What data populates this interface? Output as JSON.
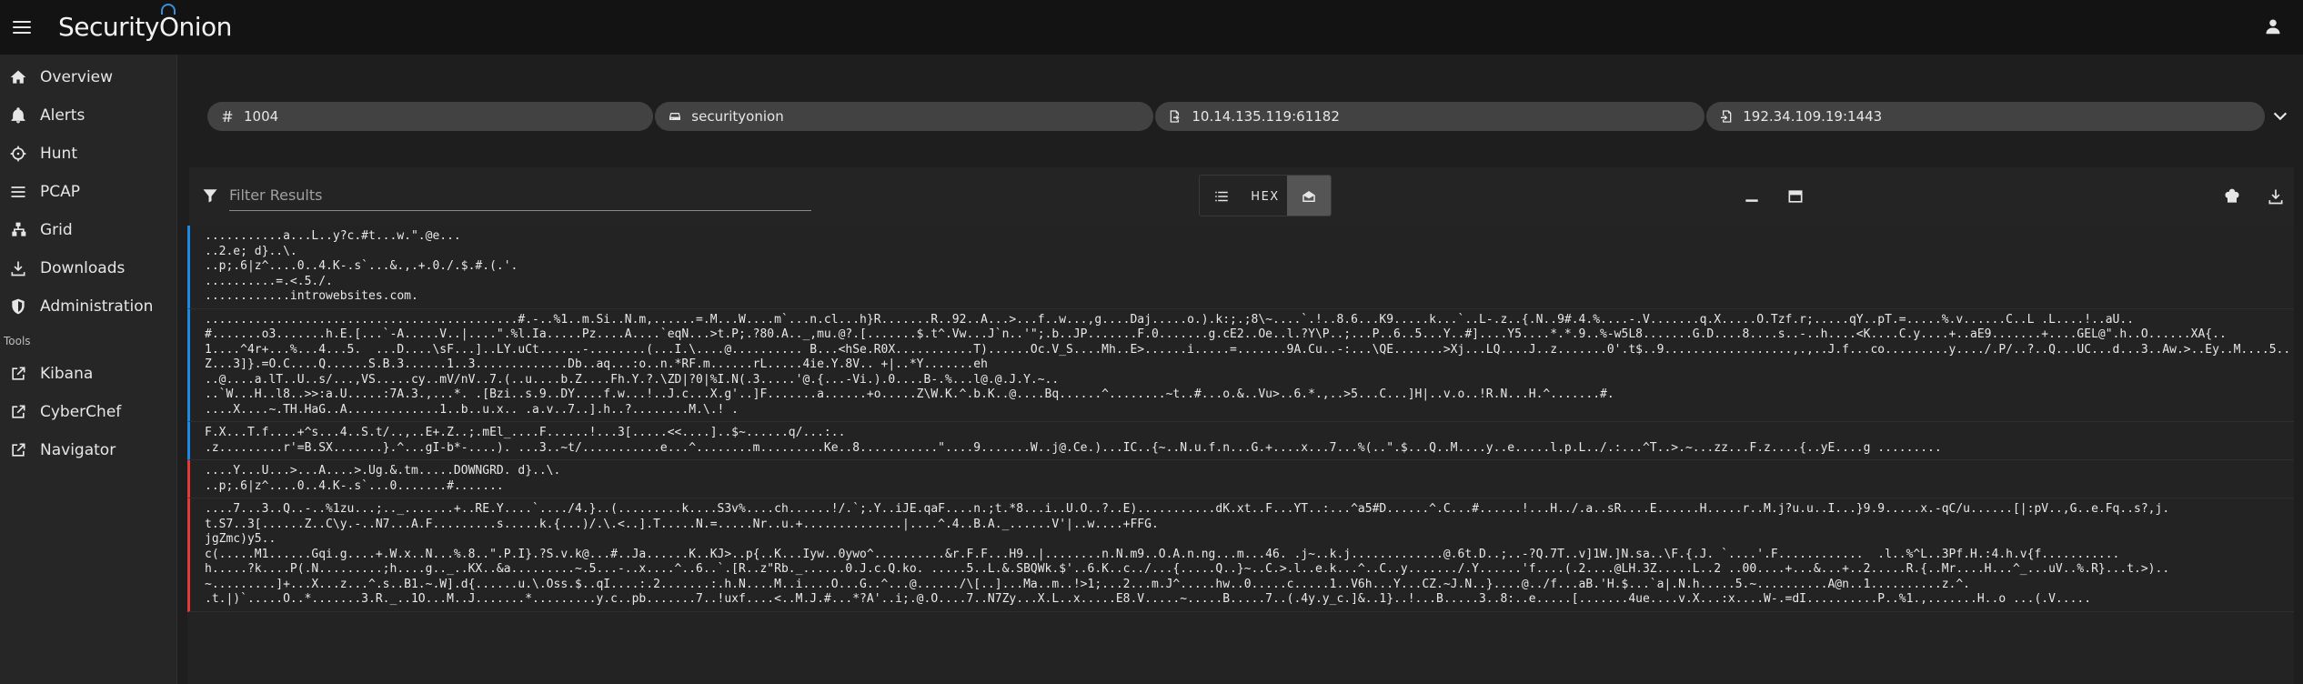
{
  "app": {
    "logo_text_1": "Security",
    "logo_text_2": "Onion"
  },
  "sidebar": {
    "items": [
      {
        "label": "Overview",
        "icon": "home-icon"
      },
      {
        "label": "Alerts",
        "icon": "bell-icon"
      },
      {
        "label": "Hunt",
        "icon": "crosshairs-icon"
      },
      {
        "label": "PCAP",
        "icon": "list-icon"
      },
      {
        "label": "Grid",
        "icon": "sitemap-icon"
      },
      {
        "label": "Downloads",
        "icon": "download-icon"
      },
      {
        "label": "Administration",
        "icon": "shield-icon"
      }
    ],
    "tools_label": "Tools",
    "tools": [
      {
        "label": "Kibana",
        "icon": "external-link-icon"
      },
      {
        "label": "CyberChef",
        "icon": "external-link-icon"
      },
      {
        "label": "Navigator",
        "icon": "external-link-icon"
      }
    ]
  },
  "chips": {
    "id": "1004",
    "sensor": "securityonion",
    "source": "10.14.135.119:61182",
    "destination": "192.34.109.19:1443"
  },
  "toolbar": {
    "filter_placeholder": "Filter Results",
    "hex_label": "HEX"
  },
  "colors": {
    "source_packet": "#1e88e5",
    "destination_packet": "#e53935",
    "active_button": "#555555"
  },
  "packets": [
    {
      "direction": "src",
      "lines": [
        "...........a...L..y?c.#t...w.\".@e...",
        "..2.e; d}..\\.",
        "..p;.6|z^....0..4.K-.s`...&.,.+.0./.$.#.(.'.",
        "..........=.<.5./.",
        "............introwebsites.com."
      ]
    },
    {
      "direction": "src",
      "lines": [
        "............................................#.-..%1..m.Si..N.m,......=.M...W....m`...n.cl...h}R.......R..92..A...>...f..w...,g....Daj.....o.).k:;.;8\\~....`.!..8.6...K9.....k...`..L-.z..{.N..9#.4.%....-.V.......q.X.....O.Tzf.r;.....qY..pT.=.....%.v......C..L .L....!..aU..",
        "#.......o3.......h.E.[...`-A.....V..|....\".%l.Ia.....Pz....A....`eqN...>t.P;.?80.A.._,mu.@?.[.......$.t^.Vw...J`n..'\";.b..JP.......F.0.......g.cE2..Oe..l.?Y\\P..;...P..6..5...Y..#]....Y5....*.*.9..%-w5L8.......G.D....8....s..-..h....<K....C.y....+..aE9.......+....GEL@\".h..O......XA{..",
        "1....^4r+...%...4...5.  ...D....\\sF...]..LY.uCt......-........(...I.\\....@.......... B...<hSe.R0X...........T)......Oc.V_S....Mh..E>......i.....=.......9A.Cu..-:...\\QE.......>Xj...LQ....J..z.......0'.t$..9..................,.,..J.f...co.........y..../.P/..?..Q...UC...d...3..Aw.>..Ey..M....5..",
        "Z...3]}.=O.C....Q......S.B.3......1..3.............Db..aq...:o..n.*RF.m......rL.....4ie.Y.8V.. +|..*Y.......eh",
        "..@....a.lT..U..s/...,VS.....cy..mV/nV..7.(..u....b.Z....Fh.Y.?.\\ZD|?0|%I.N(.3.....'@.{...-Vi.).0....B-.%...l@.@.J.Y.~..",
        "..`W...H..l8..>>:a.U.....:7A.3.,...*. .[Bzi..s.9..DY....f.w...!..J.c...X.g'..]F.......a......+o.....Z\\W.K.^.b.K..@....Bq......^........~t..#...o.&..Vu>..6.*.,..>5...C...]H|..v.o..!R.N...H.^.......#.",
        "....X....~.TH.HaG..A.............1..b..u.x.. .a.v..7..].h..?........M.\\.! ."
      ]
    },
    {
      "direction": "src",
      "lines": [
        "F.X...T.f....+^s...4..S.t/..,..E+.Z..;.mEl_....F......!...3[.....<<....]..$~......q/...:..",
        ".z.........r'=B.SX.......}.^...gI-b*-....). ...3..~t/...........e...^........m.........Ke..8...........\"....9.......W..j@.Ce.)...IC..{~..N.u.f.n...G.+....x...7...%(..\".$...Q..M....y..e.....l.p.L../.:...^T..>.~...zz...F.z....{..yE....g ........."
      ]
    },
    {
      "direction": "dst",
      "lines": [
        "....Y...U...>...A....>.Ug.&.tm.....DOWNGRD. d}..\\.",
        "..p;.6|z^....0..4.K-.s`...0.......#......."
      ]
    },
    {
      "direction": "dst",
      "lines": [
        "....7...3..Q..-..%1zu...;.._.......+..RE.Y....`..../4.}..(.........k....S3v%....ch......!/.`;.Y..iJE.qaF....n.;t.*8...i..U.O..?..E)...........dK.xt..F...YT..:...^a5#D......^.C...#......!...H../.a..sR....E......H.....r..M.j?u.u..I...}9.9.....x.-qC/u......[|:pV..,G..e.Fq..s?,j.",
        "t.S7..3[......Z..C\\y.-..N7...A.F.........s.....k.{...)/.\\.<..].T.....N.=.....Nr..u.+..............|....^.4..B.A._......V'|..w....+FFG.",
        "jgZmc)y5..",
        "c(.....M1......Gqi.g....+.W.x..N...%.8..\".P.I}.?S.v.k@...#..Ja......K..KJ>..p{..K...Iyw..0ywo^..........&r.F.F...H9..|........n.N.m9..O.A.n.ng...m...46. .j~..k.j.............@.6t.D..;..-?Q.7T..v]1W.]N.sa..\\F.{.J. `....'.F............  .l..%^L..3Pf.H.:4.h.v{f...........",
        "h.....?k....P(.N.........;h....g.._..KX..&a.........~.5...-..x....^..6..`.[R..z\"Rb._......0.J.c.Q.ko. .....5..L.&.SBQWk.$'..6.K..c../...{.....Q..}~..C.>.l..e.k...^..C..y......./.Y......'f....(.2....@LH.3Z.....L..2 ..00....+...&...+..2.....R.{..Mr....H...^_...uV..%.R}...t.>)..",
        "~.........]+...X...z...^.s..B1.~.W].d{......u.\\.Oss.$..qI....:.2.......:.h.N....M..i....O...G..^...@....../\\[..]...Ma..m..!>1;...2...m.J^.....hw..0.....c.....1..V6h...Y...CZ.~J.N..}....@../f...aB.'H.$...`a|.N.h.....5.~..........A@n..1..........z.^.",
        ".t.|)`.....O..*.......3.R._..1O...M..J.......*.........y.c..pb.......7..!uxf....<..M.J.#...*?A'..i;.@.O....7..N7Zy...X.L..x.....E8.V.....~.....B.....7..(.4y.y_c.]&..1}..!...B.....3..8:..e.....[.......4ue....v.X...:x....W-.=dI..........P..%1.,.......H..o ...(.V....."
      ]
    }
  ]
}
